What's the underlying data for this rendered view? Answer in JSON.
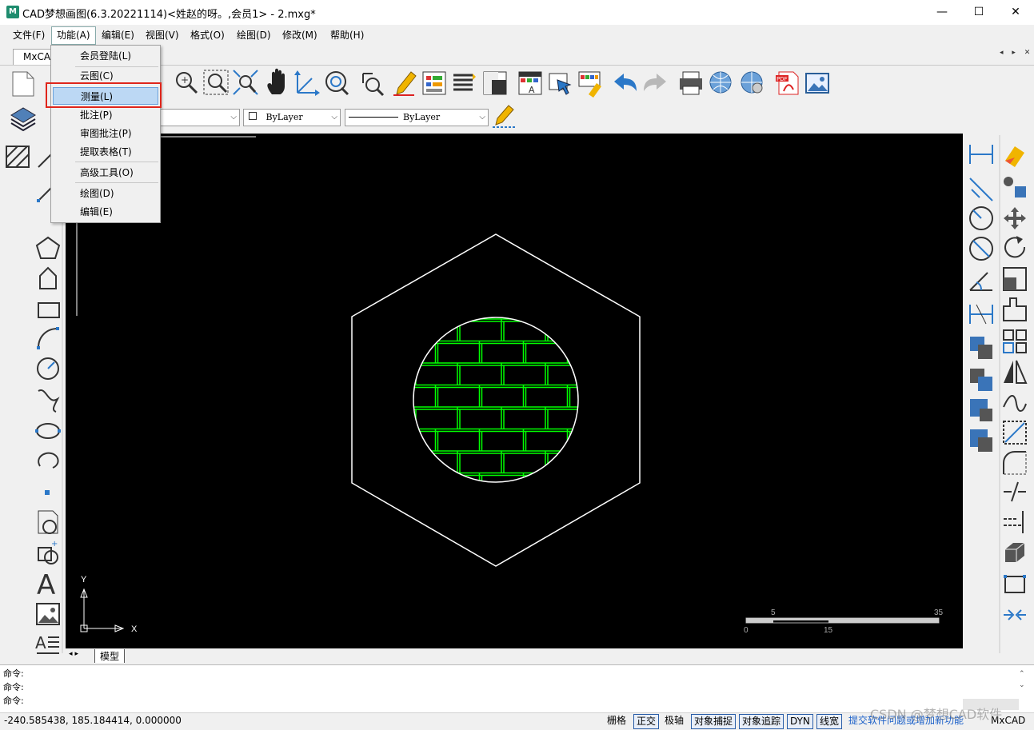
{
  "window": {
    "title": "CAD梦想画图(6.3.20221114)<姓赵的呀。,会员1> - 2.mxg*",
    "app_icon_text": "M",
    "minimize": "—",
    "maximize": "☐",
    "close": "✕"
  },
  "menubar": {
    "items": [
      {
        "label": "文件(F)"
      },
      {
        "label": "功能(A)"
      },
      {
        "label": "编辑(E)"
      },
      {
        "label": "视图(V)"
      },
      {
        "label": "格式(O)"
      },
      {
        "label": "绘图(D)"
      },
      {
        "label": "修改(M)"
      },
      {
        "label": "帮助(H)"
      }
    ]
  },
  "doc_tab": {
    "label": "MxCAD",
    "nav": "◂ ▸ ✕"
  },
  "dropdown": {
    "items": [
      {
        "label": "会员登陆(L)"
      },
      {
        "label": "云图(C)"
      },
      {
        "label": "测量(L)"
      },
      {
        "label": "批注(P)"
      },
      {
        "label": "审图批注(P)"
      },
      {
        "label": "提取表格(T)"
      },
      {
        "label": "高级工具(O)"
      },
      {
        "label": "绘图(D)"
      },
      {
        "label": "编辑(E)"
      }
    ],
    "highlighted_index": 2
  },
  "toolbar2": {
    "color_combo": "ByLayer",
    "linetype_combo": "ByLayer"
  },
  "canvas": {
    "ucs_y": "Y",
    "ucs_x": "X",
    "scale_labels": {
      "top_left": "5",
      "top_right": "35",
      "bottom_left": "0",
      "bottom_mid": "15"
    },
    "colors": {
      "background": "#000000",
      "outline": "#ffffff",
      "hatch": "#00ff00"
    }
  },
  "model_tabs": {
    "label": "模型"
  },
  "command_lines": [
    "命令:",
    "命令:",
    "命令:"
  ],
  "statusbar": {
    "coords": "-240.585438,  185.184414,  0.000000",
    "toggles": [
      {
        "label": "栅格",
        "on": false
      },
      {
        "label": "正交",
        "on": true
      },
      {
        "label": "极轴",
        "on": false
      },
      {
        "label": "对象捕捉",
        "on": true
      },
      {
        "label": "对象追踪",
        "on": true
      },
      {
        "label": "DYN",
        "on": true
      },
      {
        "label": "线宽",
        "on": true
      }
    ],
    "feedback_link": "提交软件问题或增加新功能",
    "brand": "MxCAD",
    "watermark": "CSDN @梦想CAD软件"
  },
  "icons": {
    "toolbar": [
      "new-icon",
      "open-icon",
      "zoom-window-icon",
      "zoom-realtime-icon",
      "zoom-extents-icon",
      "pan-icon",
      "ucs-icon",
      "zoom-previous-icon",
      "measure-icon",
      "pen-icon",
      "layer-manager-icon",
      "list-icon",
      "properties-icon",
      "text-style-icon",
      "select-icon",
      "color-palette-icon",
      "undo-icon",
      "redo-icon",
      "print-icon",
      "web-icon",
      "web-settings-icon",
      "pdf-icon",
      "image-icon"
    ]
  }
}
